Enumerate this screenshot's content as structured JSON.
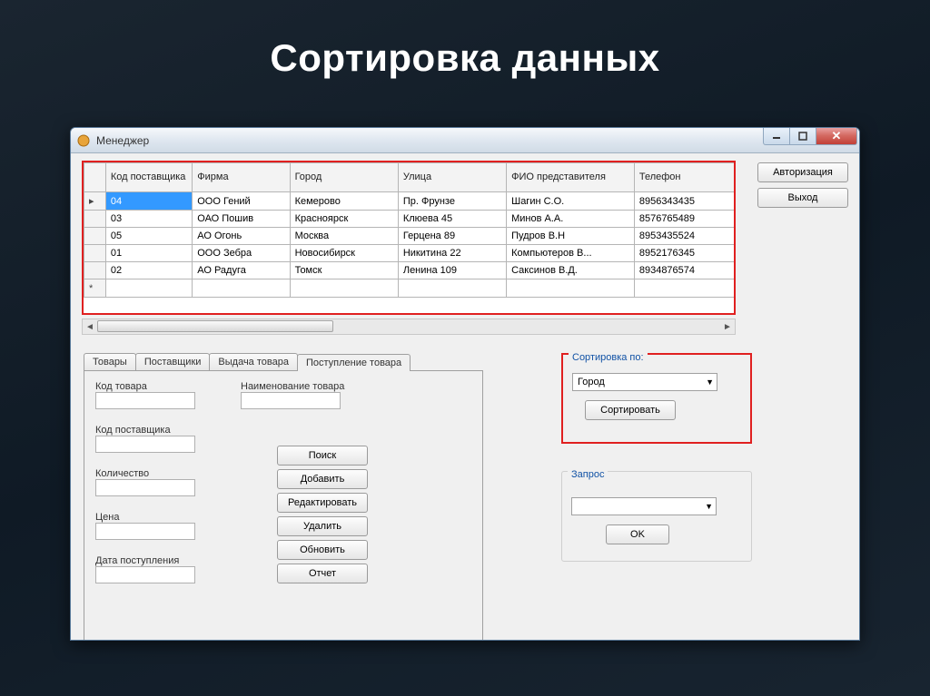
{
  "slide_title": "Сортировка данных",
  "window": {
    "title": "Менеджер",
    "buttons": {
      "auth": "Авторизация",
      "exit": "Выход"
    }
  },
  "grid": {
    "headers": [
      "Код поставщика",
      "Фирма",
      "Город",
      "Улица",
      "ФИО представителя",
      "Телефон"
    ],
    "rows": [
      {
        "sel": true,
        "marker": "▸",
        "cells": [
          "04",
          "ООО Гений",
          "Кемерово",
          "Пр. Фрунзе",
          "Шагин С.О.",
          "8956343435"
        ]
      },
      {
        "sel": false,
        "marker": "",
        "cells": [
          "03",
          "ОАО Пошив",
          "Красноярск",
          "Клюева 45",
          "Минов А.А.",
          "8576765489"
        ]
      },
      {
        "sel": false,
        "marker": "",
        "cells": [
          "05",
          "АО Огонь",
          "Москва",
          "Герцена 89",
          "Пудров В.Н",
          "8953435524"
        ]
      },
      {
        "sel": false,
        "marker": "",
        "cells": [
          "01",
          "ООО Зебра",
          "Новосибирск",
          "Никитина 22",
          "Компьютеров В...",
          "8952176345"
        ]
      },
      {
        "sel": false,
        "marker": "",
        "cells": [
          "02",
          "АО Радуга",
          "Томск",
          "Ленина 109",
          "Саксинов В.Д.",
          "8934876574"
        ]
      }
    ]
  },
  "tabs": {
    "items": [
      "Товары",
      "Поставщики",
      "Выдача товара",
      "Поступление товара"
    ],
    "active_index": 3
  },
  "form": {
    "labels": {
      "code": "Код товара",
      "name": "Наименование товара",
      "supplier": "Код поставщика",
      "qty": "Количество",
      "price": "Цена",
      "date": "Дата поступления"
    },
    "buttons": {
      "search": "Поиск",
      "add": "Добавить",
      "edit": "Редактировать",
      "delete": "Удалить",
      "refresh": "Обновить",
      "report": "Отчет"
    }
  },
  "sort": {
    "group": "Сортировка по:",
    "value": "Город",
    "button": "Сортировать"
  },
  "query": {
    "group": "Запрос",
    "value": "",
    "button": "OK"
  }
}
